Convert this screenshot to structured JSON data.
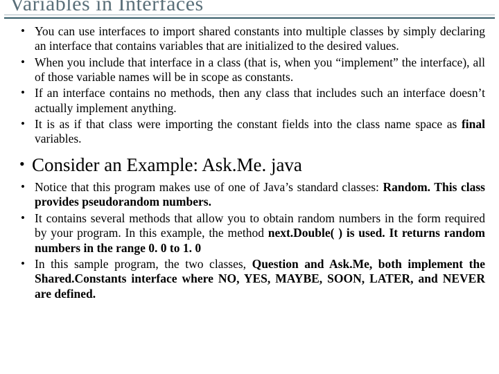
{
  "title": "Variables in Interfaces",
  "bullets_top": [
    "You can use interfaces to import shared constants into multiple classes by simply declaring an interface that contains variables that are initialized to the desired values.",
    "When you include that interface in a class (that is, when you “implement” the interface), all of those variable names will be in scope as constants.",
    "If an interface contains no methods, then any class that includes such an interface doesn’t actually implement anything.",
    "It is as if that class were importing the constant fields into the class name space as <b>final</b> variables."
  ],
  "example_line": "Consider an Example: Ask.Me. java",
  "bullets_bottom": [
    "Notice that this program makes use of one of Java’s standard classes: <b>Random. This class provides pseudorandom numbers.</b>",
    "It contains several methods that allow you to obtain random numbers in the form required by your program. In this example, the method <b>next.Double( ) is used. It returns random numbers in the range 0. 0 to 1. 0</b>",
    "In this sample program, the two classes, <b>Question and Ask.Me, both implement the Shared.Constants interface where NO, YES, MAYBE, SOON, LATER, and NEVER are defined.</b>"
  ]
}
